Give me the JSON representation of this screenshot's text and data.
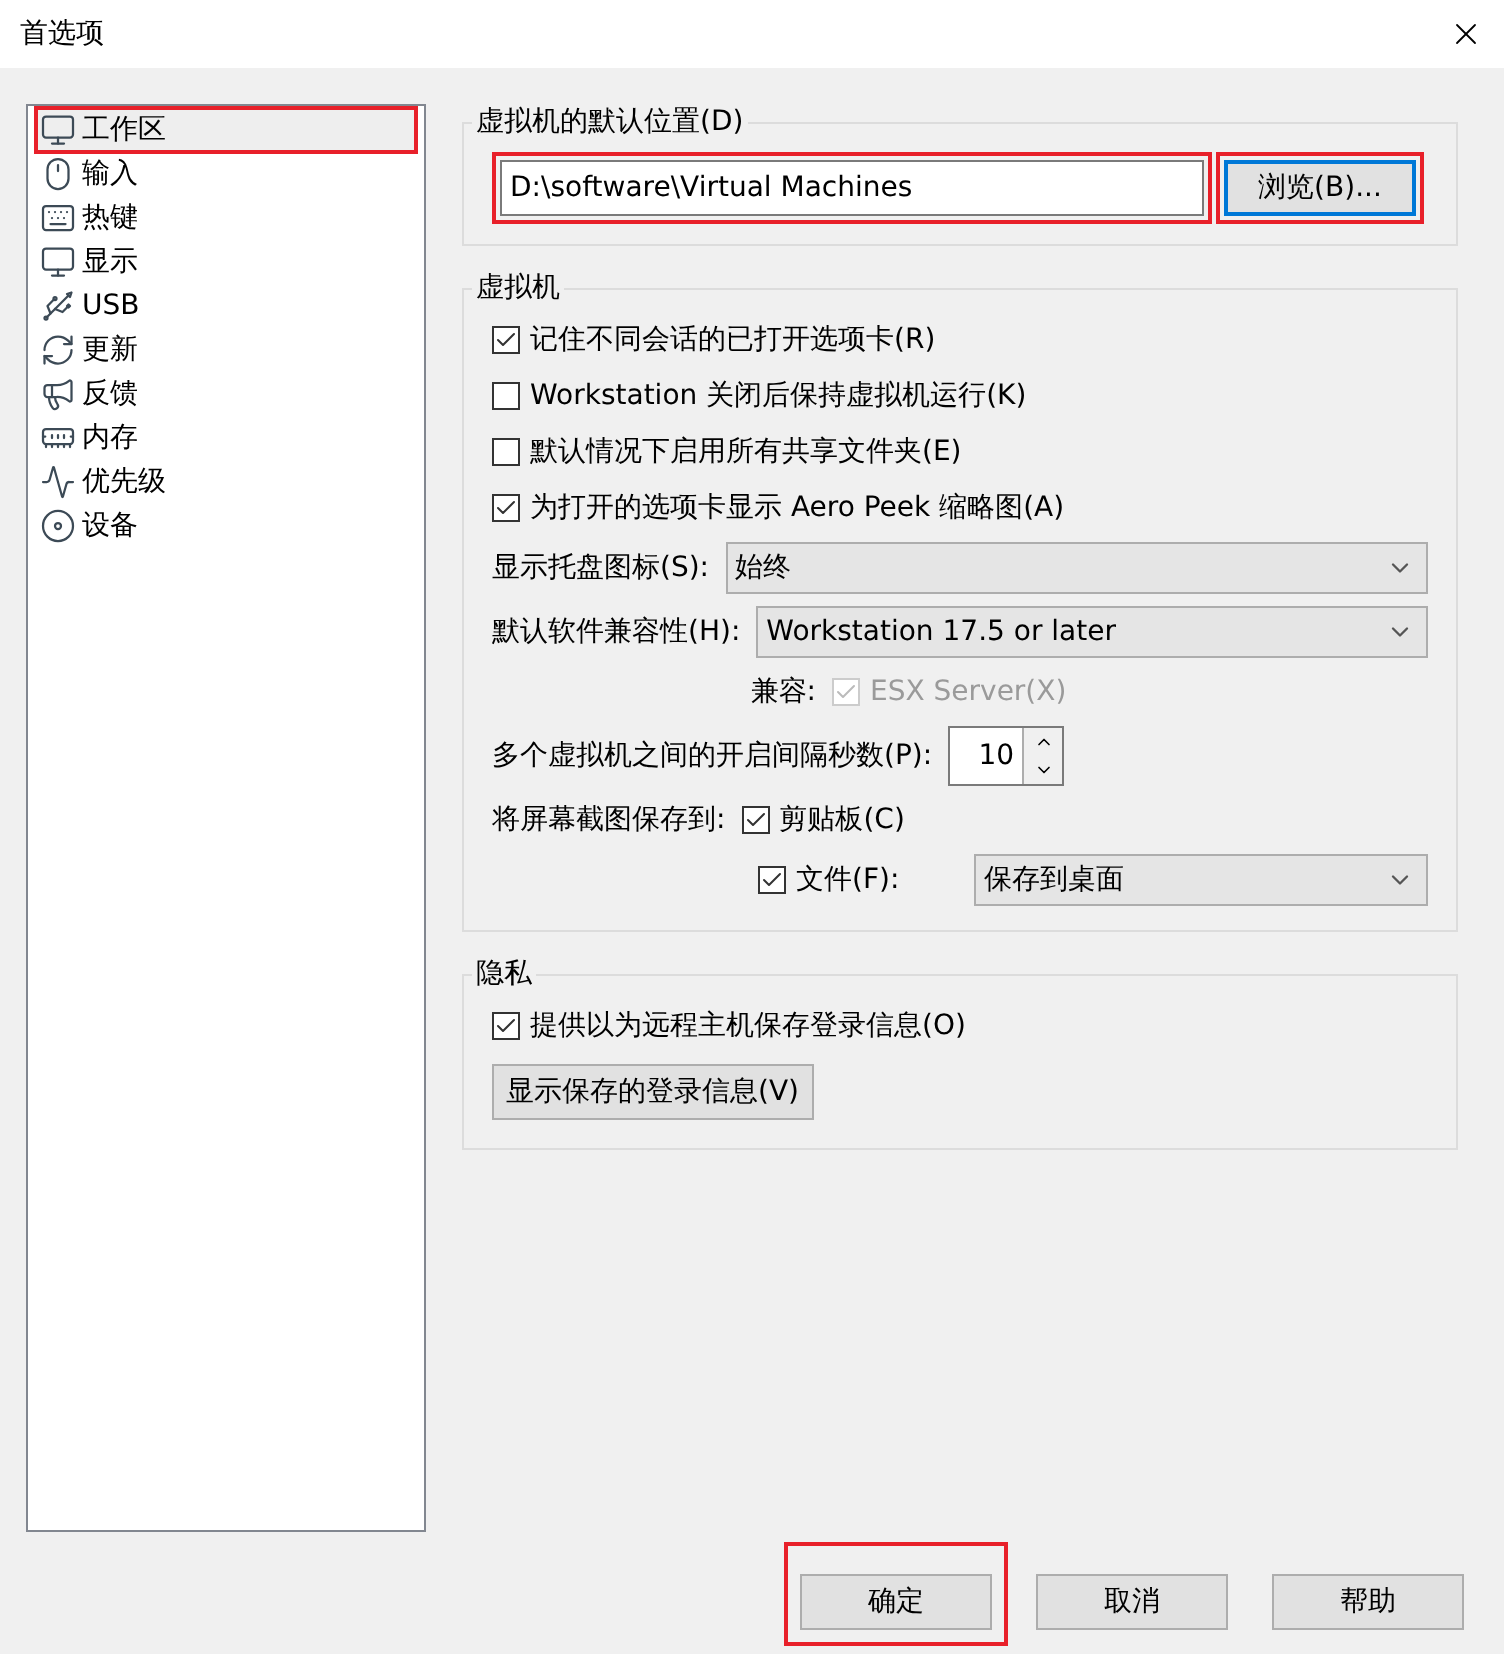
{
  "window": {
    "title": "首选项"
  },
  "sidebar": {
    "items": [
      {
        "label": "工作区",
        "selected": true,
        "highlighted": true
      },
      {
        "label": "输入",
        "selected": false,
        "highlighted": false
      },
      {
        "label": "热键",
        "selected": false,
        "highlighted": false
      },
      {
        "label": "显示",
        "selected": false,
        "highlighted": false
      },
      {
        "label": "USB",
        "selected": false,
        "highlighted": false
      },
      {
        "label": "更新",
        "selected": false,
        "highlighted": false
      },
      {
        "label": "反馈",
        "selected": false,
        "highlighted": false
      },
      {
        "label": "内存",
        "selected": false,
        "highlighted": false
      },
      {
        "label": "优先级",
        "selected": false,
        "highlighted": false
      },
      {
        "label": "设备",
        "selected": false,
        "highlighted": false
      }
    ]
  },
  "location_group": {
    "title": "虚拟机的默认位置(D)",
    "path": {
      "value": "D:\\software\\Virtual Machines",
      "highlighted": true
    },
    "browse_button": {
      "label": "浏览(B)...",
      "highlighted": true
    }
  },
  "vm_group": {
    "title": "虚拟机",
    "rows": [
      {
        "kind": "checkbox",
        "label": "记住不同会话的已打开选项卡(R)",
        "checked": true
      },
      {
        "kind": "checkbox",
        "label": "Workstation 关闭后保持虚拟机运行(K)",
        "checked": false
      },
      {
        "kind": "checkbox",
        "label": "默认情况下启用所有共享文件夹(E)",
        "checked": false
      },
      {
        "kind": "checkbox",
        "label": "为打开的选项卡显示 Aero Peek 缩略图(A)",
        "checked": true
      },
      {
        "kind": "select",
        "label": "显示托盘图标(S):",
        "value": "始终"
      },
      {
        "kind": "select",
        "label": "默认软件兼容性(H):",
        "value": "Workstation 17.5 or later"
      },
      {
        "kind": "compat",
        "label": "兼容:",
        "option": {
          "label": "ESX Server(X)",
          "checked": true,
          "disabled": true
        }
      },
      {
        "kind": "spinner",
        "label": "多个虚拟机之间的开启间隔秒数(P):",
        "value": "10"
      },
      {
        "kind": "save_to",
        "label": "将屏幕截图保存到:",
        "clipboard": {
          "label": "剪贴板(C)",
          "checked": true
        },
        "file": {
          "label": "文件(F):",
          "checked": true
        },
        "file_target": "保存到桌面"
      }
    ]
  },
  "privacy_group": {
    "title": "隐私",
    "checkbox": {
      "label": "提供以为远程主机保存登录信息(O)",
      "checked": true
    },
    "button": {
      "label": "显示保存的登录信息(V)"
    }
  },
  "buttons": [
    {
      "label": "确定",
      "highlighted": true
    },
    {
      "label": "取消",
      "highlighted": false
    },
    {
      "label": "帮助",
      "highlighted": false
    }
  ]
}
